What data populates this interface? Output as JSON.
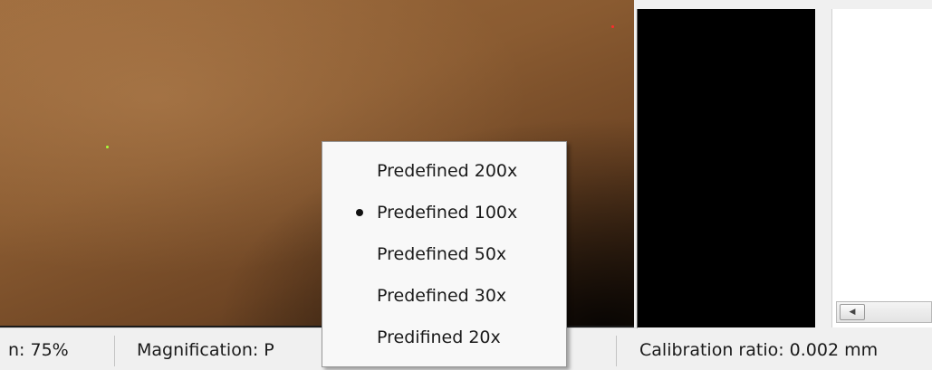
{
  "status_bar": {
    "zoom_text": "n: 75%",
    "magnification_text": "Magnification: P",
    "calibration_text": "Calibration ratio: 0.002 mm"
  },
  "context_menu": {
    "items": [
      {
        "label": "Predefined 200x",
        "selected": false
      },
      {
        "label": "Predefined 100x",
        "selected": true
      },
      {
        "label": "Predefined 50x",
        "selected": false
      },
      {
        "label": "Predefined 30x",
        "selected": false
      },
      {
        "label": "Predifined 20x",
        "selected": false
      }
    ]
  },
  "scrollbar": {
    "left_arrow_icon": "arrow-left-icon"
  },
  "colors": {
    "image_tone": "#8a5b31",
    "menu_background": "#f8f8f8",
    "status_background": "#f0f0f0"
  }
}
